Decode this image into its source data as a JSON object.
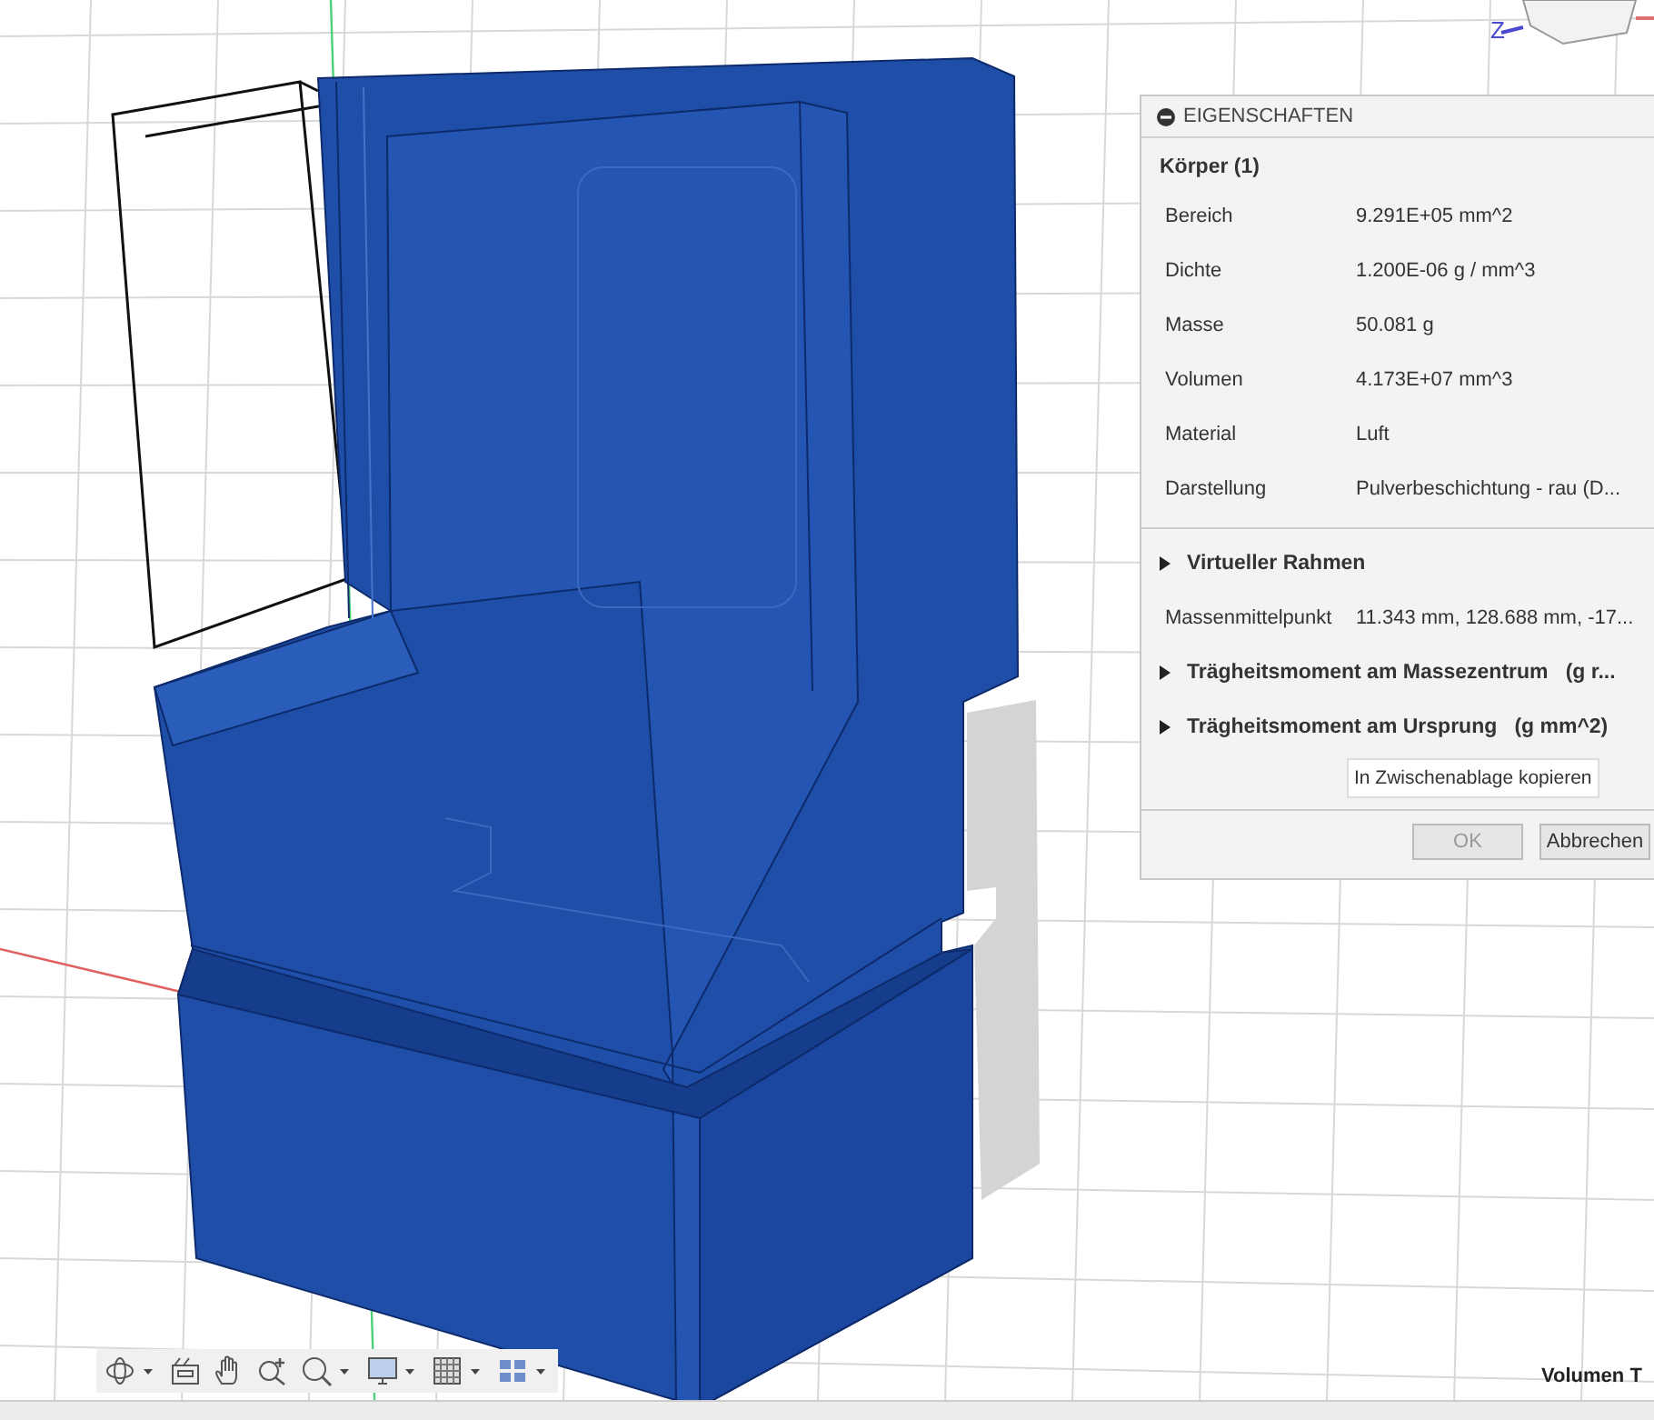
{
  "view_cube": {
    "axis_label": "Z"
  },
  "properties_panel": {
    "title": "EIGENSCHAFTEN",
    "collapsed": false,
    "body_heading": "Körper (1)",
    "rows": [
      {
        "label": "Bereich",
        "value": "9.291E+05 mm^2"
      },
      {
        "label": "Dichte",
        "value": "1.200E-06 g / mm^3"
      },
      {
        "label": "Masse",
        "value": "50.081 g"
      },
      {
        "label": "Volumen",
        "value": "4.173E+07 mm^3"
      },
      {
        "label": "Material",
        "value": "Luft"
      },
      {
        "label": "Darstellung",
        "value": "Pulverbeschichtung - rau (D..."
      }
    ],
    "sections": [
      {
        "kind": "section",
        "label": "Virtueller Rahmen",
        "expanded": false
      },
      {
        "kind": "row",
        "label": "Massenmittelpunkt",
        "value": "11.343 mm, 128.688 mm, -17..."
      },
      {
        "kind": "section",
        "label": "Trägheitsmoment am Massezentrum   (g r...",
        "expanded": false
      },
      {
        "kind": "section",
        "label": "Trägheitsmoment am Ursprung   (g mm^2)",
        "expanded": false
      }
    ],
    "copy_button": "In Zwischenablage kopieren",
    "buttons": [
      {
        "label": "OK",
        "disabled": true
      },
      {
        "label": "Abbrechen",
        "disabled": false
      }
    ]
  },
  "status_text": "Volumen T"
}
